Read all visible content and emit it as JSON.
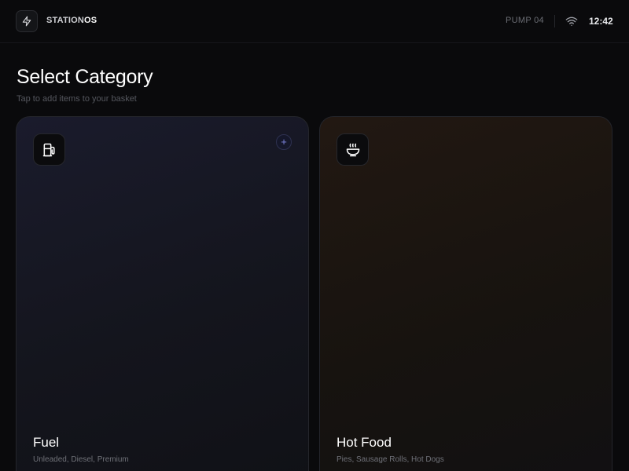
{
  "header": {
    "brand_part1": "STATION",
    "brand_part2": "OS",
    "logo_icon": "lightning-bolt-icon",
    "pump": "PUMP 04",
    "wifi_icon": "wifi-icon",
    "time": "12:42"
  },
  "page": {
    "title": "Select Category",
    "subtitle": "Tap to add items to your basket"
  },
  "categories": [
    {
      "name": "Fuel",
      "description": "Unleaded, Diesel, Premium",
      "icon": "fuel-pump-icon",
      "action": "+",
      "accent": "#7f86e0"
    },
    {
      "name": "Hot Food",
      "description": "Pies, Sausage Rolls, Hot Dogs",
      "icon": "hot-bowl-icon",
      "accent": "#c27a3a"
    }
  ]
}
